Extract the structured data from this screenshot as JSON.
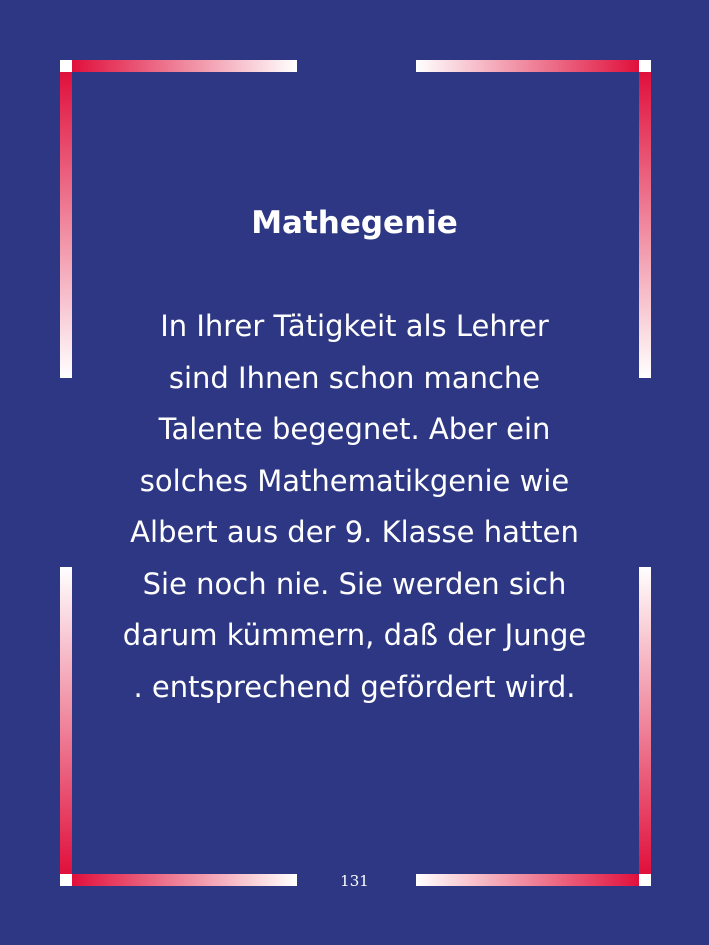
{
  "card": {
    "title": "Mathegenie",
    "lines": [
      "In Ihrer Tätigkeit als Lehrer",
      "sind Ihnen schon manche",
      "Talente begegnet. Aber ein",
      "solches Mathematikgenie wie",
      "Albert aus der 9. Klasse hatten",
      "Sie noch nie. Sie werden sich",
      "darum kümmern, daß der Junge",
      ". entsprechend gefördert wird."
    ],
    "page_number": "131"
  },
  "colors": {
    "background": "#2e3783",
    "frame_red": "#e0103c",
    "frame_white": "#ffffff",
    "text": "#ffffff"
  }
}
